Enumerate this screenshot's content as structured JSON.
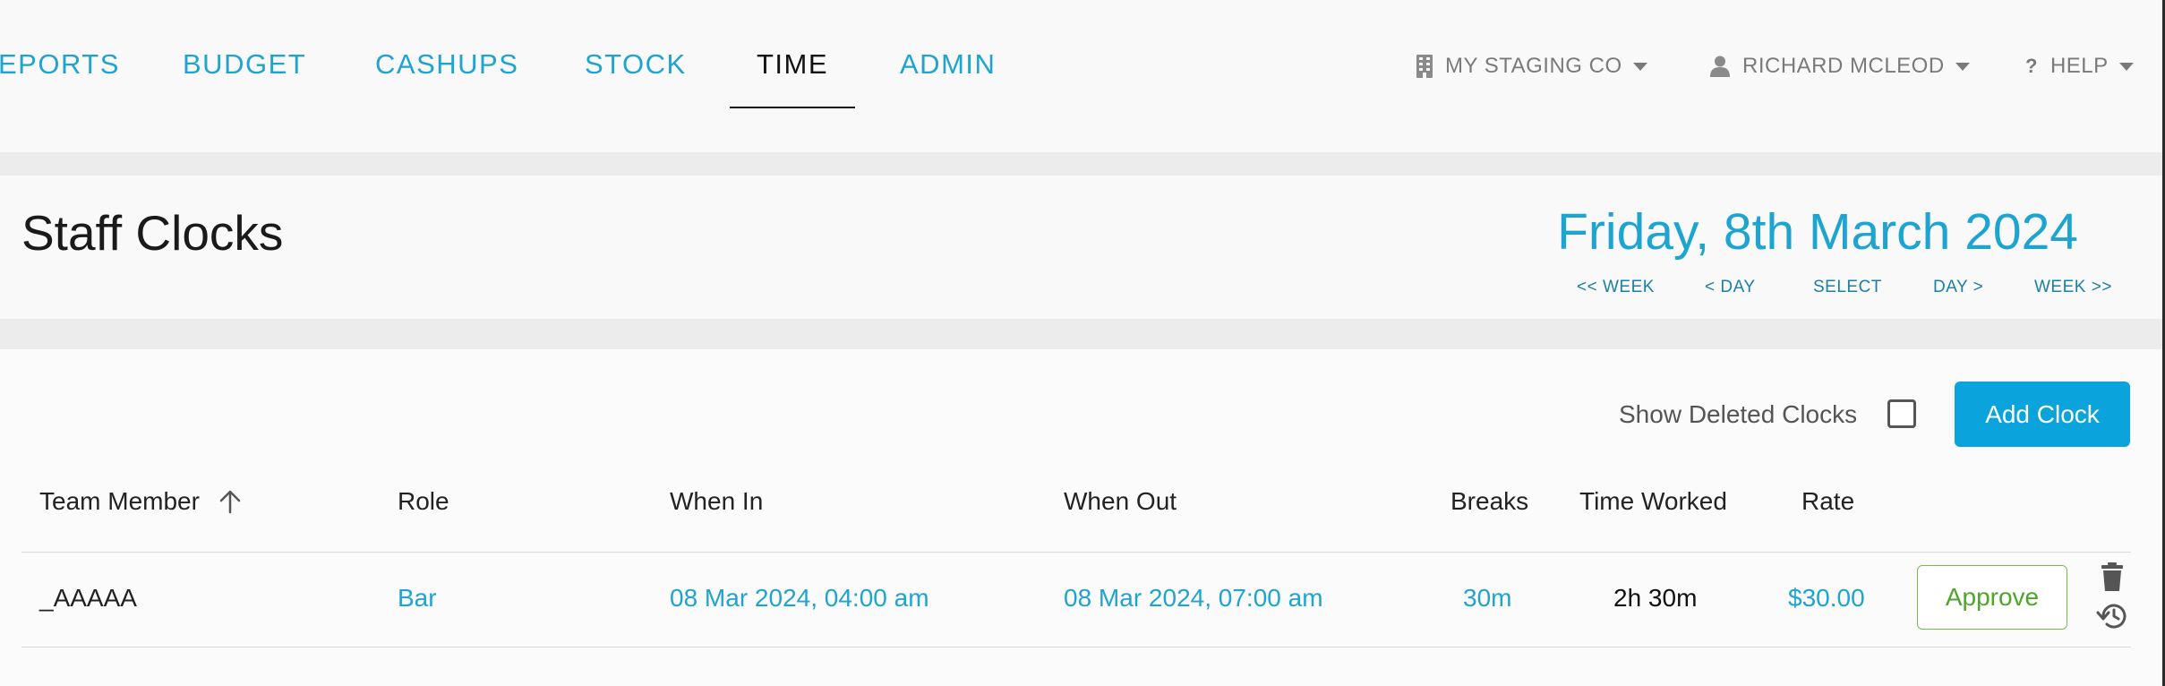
{
  "nav": {
    "items": [
      {
        "label": "EPORTS"
      },
      {
        "label": "BUDGET"
      },
      {
        "label": "CASHUPS"
      },
      {
        "label": "STOCK"
      },
      {
        "label": "TIME"
      },
      {
        "label": "ADMIN"
      }
    ],
    "active": "TIME",
    "company": "MY STAGING CO",
    "user": "RICHARD MCLEOD",
    "help": "HELP"
  },
  "header": {
    "title": "Staff Clocks",
    "date": "Friday, 8th March 2024",
    "date_nav": {
      "prev_week": "<< WEEK",
      "prev_day": "< DAY",
      "select": "SELECT",
      "next_day": "DAY >",
      "next_week": "WEEK >>"
    }
  },
  "controls": {
    "show_deleted_label": "Show Deleted Clocks",
    "show_deleted_checked": false,
    "add_clock_label": "Add Clock"
  },
  "table": {
    "columns": {
      "team_member": "Team Member",
      "role": "Role",
      "when_in": "When In",
      "when_out": "When Out",
      "breaks": "Breaks",
      "time_worked": "Time Worked",
      "rate": "Rate"
    },
    "rows": [
      {
        "team_member": "_AAAAA",
        "role": "Bar",
        "when_in": "08 Mar 2024, 04:00 am",
        "when_out": "08 Mar 2024, 07:00 am",
        "breaks": "30m",
        "time_worked": "2h 30m",
        "rate": "$30.00",
        "approve_label": "Approve"
      }
    ]
  },
  "colors": {
    "accent": "#1ea4d0",
    "primary_button": "#0aa3dc",
    "approve": "#4ea52a"
  },
  "icons": {
    "company": "building-icon",
    "user": "user-icon",
    "help": "question-icon",
    "sort": "arrow-up-icon",
    "delete": "trash-icon",
    "history": "history-icon"
  }
}
